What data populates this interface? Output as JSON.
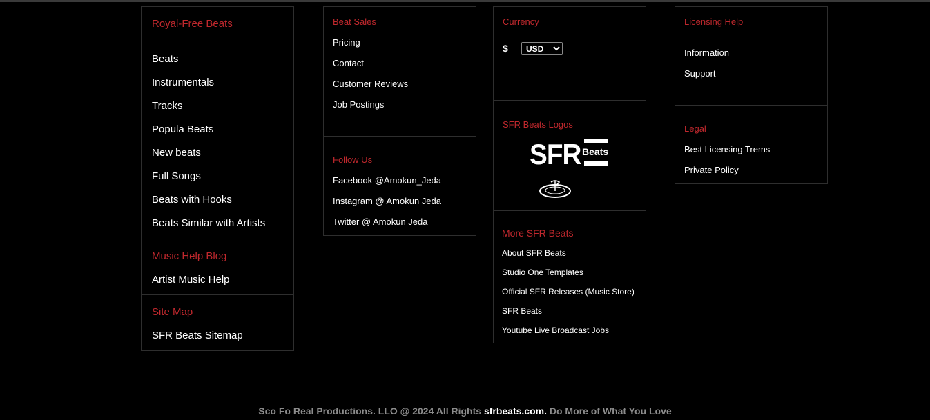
{
  "col1": {
    "royalty_title": "Royal-Free Beats",
    "royalty_links": [
      "Beats",
      "Instrumentals",
      "Tracks",
      "Popula Beats",
      "New beats",
      "Full Songs",
      "Beats with Hooks",
      "Beats Similar with Artists"
    ],
    "blog_title": "Music Help Blog",
    "blog_links": [
      "Artist Music Help"
    ],
    "sitemap_title": "Site Map",
    "sitemap_links": [
      "SFR Beats Sitemap"
    ]
  },
  "col2": {
    "sales_title": "Beat Sales",
    "sales_links": [
      "Pricing",
      "Contact",
      "Customer Reviews",
      "Job Postings"
    ],
    "follow_title": "Follow Us",
    "follow_links": [
      "Facebook @Amokun_Jeda",
      "Instagram @ Amokun Jeda",
      "Twitter @ Amokun Jeda"
    ]
  },
  "col3": {
    "currency_title": "Currency",
    "currency_symbol": "$",
    "currency_selected": "USD",
    "logos_title": "SFR Beats Logos",
    "logo_sfr": "SFR",
    "logo_beats": "Beats",
    "more_title": "More SFR Beats",
    "more_links": [
      "About SFR Beats",
      "Studio One Templates",
      "Official SFR Releases (Music Store)",
      "SFR Beats",
      "Youtube Live Broadcast Jobs"
    ]
  },
  "col4": {
    "licensing_title": "Licensing Help",
    "licensing_links": [
      "Information",
      "Support"
    ],
    "legal_title": "Legal",
    "legal_links": [
      "Best Licensing Trems",
      "Private Policy"
    ]
  },
  "footer": {
    "prefix": "Sco Fo Real Productions. LLO @ 2024 All Rights ",
    "site": "sfrbeats.com.",
    "suffix": " Do More of What You Love"
  },
  "colors": {
    "accent": "#c0282d",
    "background": "#000000",
    "border": "#2e2e2e"
  }
}
